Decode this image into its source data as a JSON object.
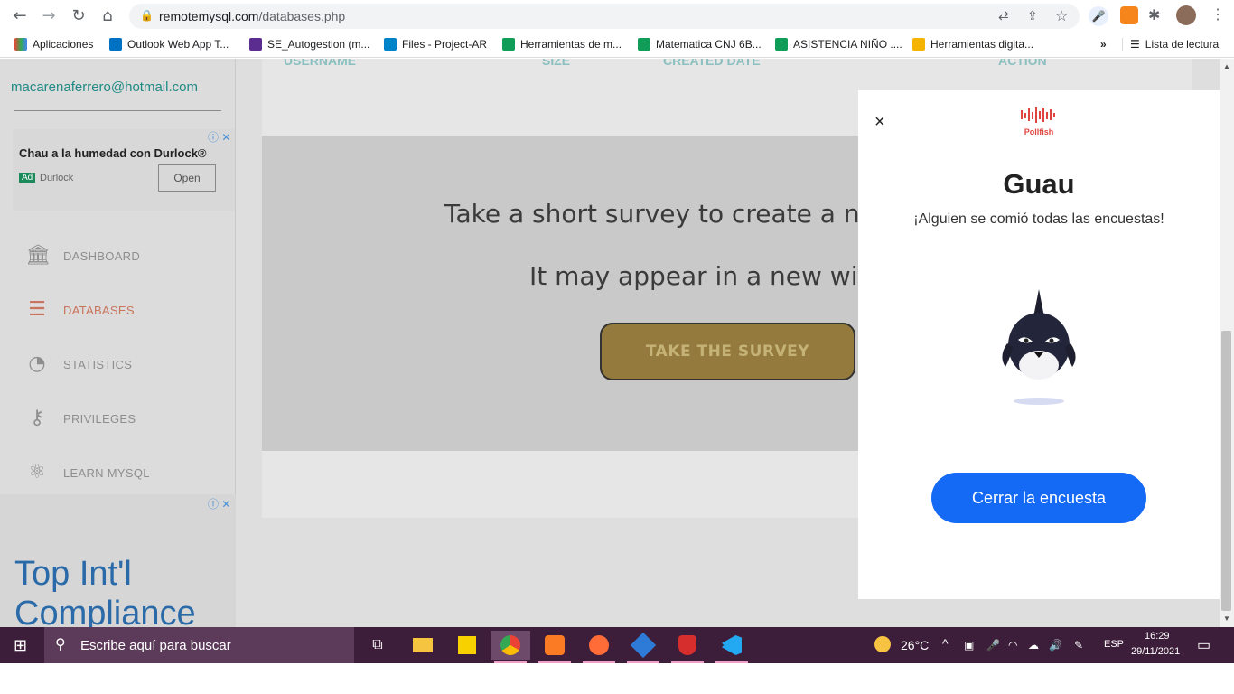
{
  "browser": {
    "url_host": "remotemysql.com",
    "url_path": "/databases.php",
    "bookmarks": [
      {
        "label": "Aplicaciones",
        "color": "#ea4335"
      },
      {
        "label": "Outlook Web App T...",
        "color": "#0072c6"
      },
      {
        "label": "SE_Autogestion (m...",
        "color": "#5c2d91"
      },
      {
        "label": "Files - Project-AR",
        "color": "#0082c9"
      },
      {
        "label": "Herramientas de m...",
        "color": "#0f9d58"
      },
      {
        "label": "Matematica CNJ 6B...",
        "color": "#0f9d58"
      },
      {
        "label": "ASISTENCIA NIÑO ....",
        "color": "#0f9d58"
      },
      {
        "label": "Herramientas digita...",
        "color": "#f4b400"
      }
    ],
    "more_bookmarks": "»",
    "reading_list": "Lista de lectura"
  },
  "sidebar": {
    "email": "macarenaferrero@hotmail.com",
    "ad_top": {
      "headline": "Chau a la humedad con Durlock®",
      "badge": "Ad",
      "advertiser": "Durlock",
      "button": "Open"
    },
    "items": [
      {
        "label": "DASHBOARD",
        "icon": "bank-icon",
        "active": false
      },
      {
        "label": "DATABASES",
        "icon": "list-icon",
        "active": true
      },
      {
        "label": "STATISTICS",
        "icon": "pie-chart-icon",
        "active": false
      },
      {
        "label": "PRIVILEGES",
        "icon": "key-icon",
        "active": false
      },
      {
        "label": "LEARN MYSQL",
        "icon": "atom-icon",
        "active": false
      }
    ],
    "ad_bottom": {
      "text_line1": "Top Int'l",
      "text_line2": "Compliance"
    }
  },
  "main": {
    "columns": [
      "USERNAME",
      "SIZE",
      "CREATED DATE",
      "ACTION"
    ],
    "survey_line1": "Take a short survey to create a ne",
    "survey_line2": "It may appear in a new wir",
    "survey_button": "TAKE THE SURVEY"
  },
  "modal": {
    "close_glyph": "×",
    "brand": "Pollfish",
    "title": "Guau",
    "subtitle": "¡Alguien se comió todas las encuestas!",
    "button": "Cerrar la encuesta"
  },
  "taskbar": {
    "search_placeholder": "Escribe aquí para buscar",
    "weather": "26°C",
    "language": "ESP",
    "time": "16:29",
    "date": "29/11/2021"
  }
}
